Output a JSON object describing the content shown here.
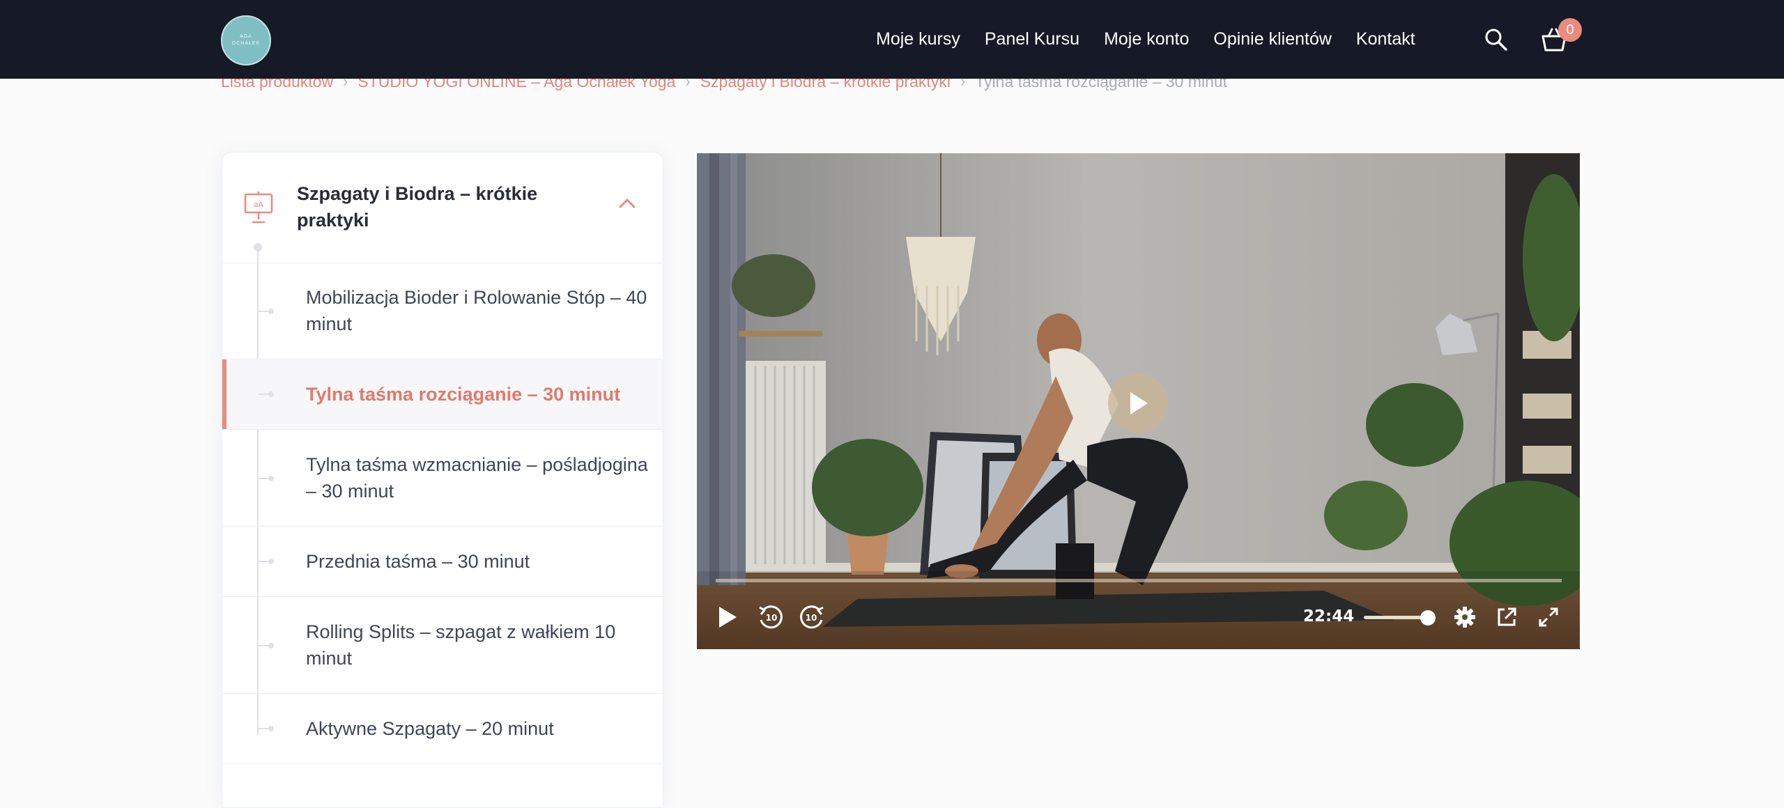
{
  "header": {
    "logo_text_1": "AGA",
    "logo_text_2": "OCHAŁEK",
    "nav": [
      "Moje kursy",
      "Panel Kursu",
      "Moje konto",
      "Opinie klientów",
      "Kontakt"
    ],
    "cart_count": "0",
    "icons": [
      "search-icon",
      "cart-icon"
    ]
  },
  "breadcrumb": [
    "Lista produktów",
    "STUDIO YOGI ONLINE – Aga Ochałek Yoga",
    "Szpagaty i Biodra – krótkie praktyki",
    "Tylna taśma rozciąganie – 30 minut"
  ],
  "sidebar": {
    "section_title": "Szpagaty i Biodra – krótkie praktyki",
    "section_icon": "presentation-icon",
    "lessons": [
      {
        "label": "Mobilizacja Bioder i Rolowanie Stóp – 40 minut",
        "active": false
      },
      {
        "label": "Tylna taśma rozciąganie – 30 minut",
        "active": true
      },
      {
        "label": "Tylna taśma wzmacnianie – pośladjogina – 30 minut",
        "active": false
      },
      {
        "label": "Przednia taśma – 30 minut",
        "active": false
      },
      {
        "label": "Rolling Splits – szpagat z wałkiem 10 minut",
        "active": false
      },
      {
        "label": "Aktywne Szpagaty – 20 minut",
        "active": false
      }
    ]
  },
  "video": {
    "time": "22:44",
    "progress": 0.0,
    "volume": 1.0,
    "controls": [
      "play-icon",
      "rewind-10-icon",
      "forward-10-icon",
      "settings-icon",
      "popout-icon",
      "fullscreen-icon"
    ],
    "skip_seconds": "10"
  },
  "colors": {
    "header_bg": "#151a26",
    "accent": "#e98b7d",
    "active_text": "#e07a6c"
  }
}
